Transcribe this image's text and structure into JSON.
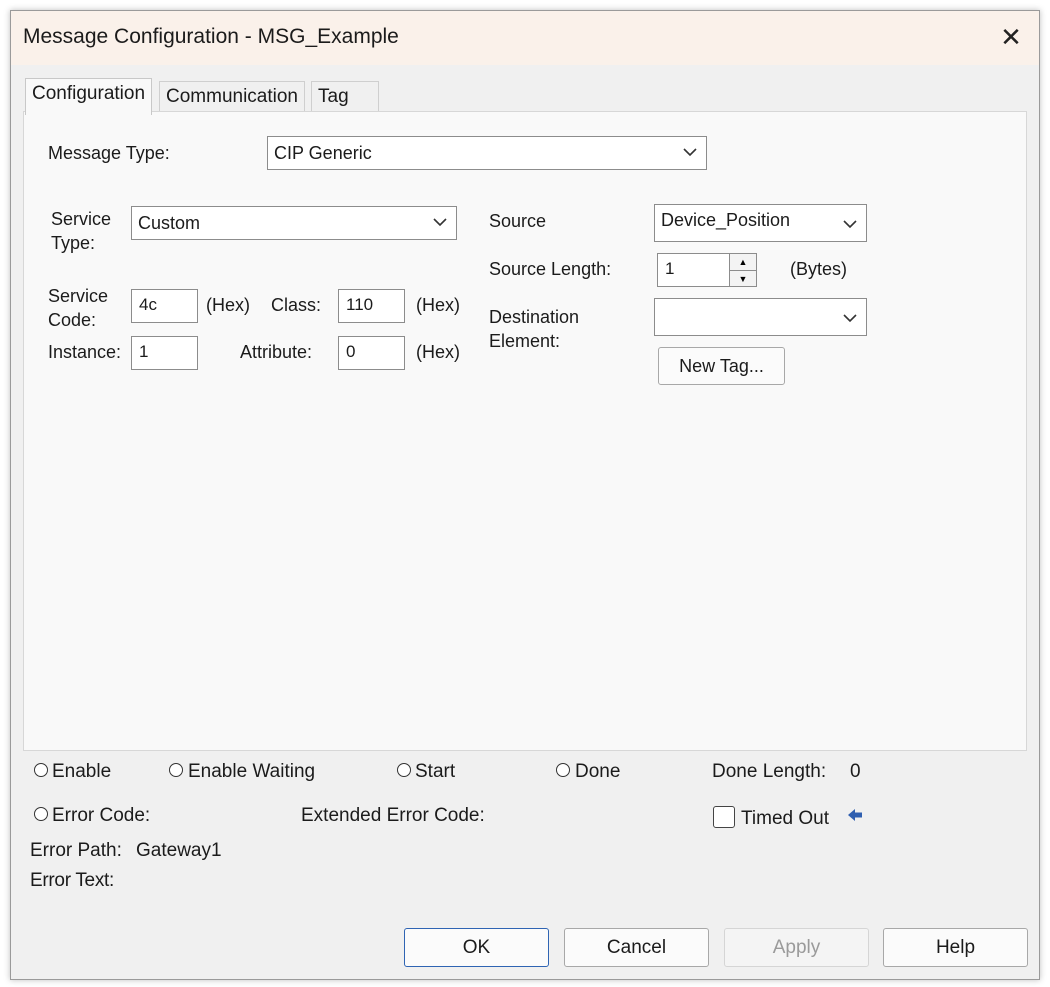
{
  "window": {
    "title": "Message Configuration - MSG_Example"
  },
  "tabs": [
    {
      "label": "Configuration"
    },
    {
      "label": "Communication"
    },
    {
      "label": "Tag"
    }
  ],
  "config": {
    "message_type_label": "Message Type:",
    "message_type_value": "CIP Generic",
    "service_type_label": "Service\nType:",
    "service_type_value": "Custom",
    "service_code_label": "Service\nCode:",
    "service_code_value": "4c",
    "hex_label": "(Hex)",
    "class_label": "Class:",
    "class_value": "110",
    "instance_label": "Instance:",
    "instance_value": "1",
    "attribute_label": "Attribute:",
    "attribute_value": "0",
    "source_label": "Source",
    "source_value": "Device_Position",
    "source_length_label": "Source Length:",
    "source_length_value": "1",
    "bytes_label": "(Bytes)",
    "destination_label": "Destination\nElement:",
    "destination_value": "",
    "new_tag_label": "New Tag..."
  },
  "status": {
    "enable": "Enable",
    "enable_waiting": "Enable Waiting",
    "start": "Start",
    "done": "Done",
    "done_length_label": "Done Length:",
    "done_length_value": "0",
    "error_code": "Error Code:",
    "extended_error_code": "Extended Error Code:",
    "timed_out": "Timed Out",
    "error_path_label": "Error Path:",
    "error_path_value": "Gateway1",
    "error_text_label": "Error Text:"
  },
  "buttons": {
    "ok": "OK",
    "cancel": "Cancel",
    "apply": "Apply",
    "help": "Help"
  },
  "colors": {
    "accent": "#2f64b3",
    "titlebar": "#faf1ea"
  }
}
